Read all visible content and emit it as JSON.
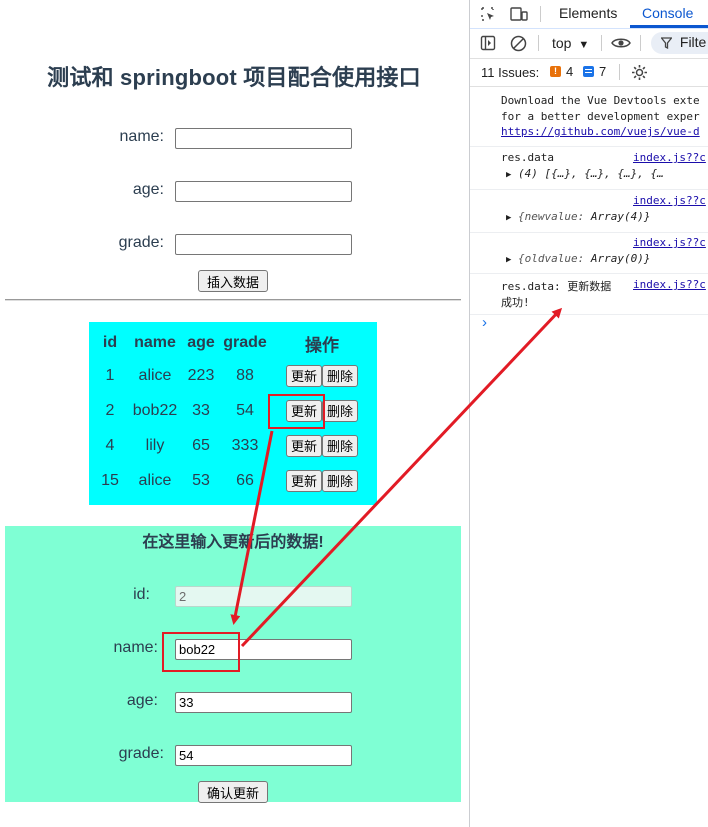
{
  "page": {
    "title": "测试和 springboot 项目配合使用接口"
  },
  "insert_form": {
    "name_label": "name:",
    "age_label": "age:",
    "grade_label": "grade:",
    "name_value": "",
    "age_value": "",
    "grade_value": "",
    "submit_label": "插入数据"
  },
  "table": {
    "headers": [
      "id",
      "name",
      "age",
      "grade",
      "操作"
    ],
    "rows": [
      {
        "id": "1",
        "name": "alice",
        "age": "223",
        "grade": "88"
      },
      {
        "id": "2",
        "name": "bob22",
        "age": "33",
        "grade": "54"
      },
      {
        "id": "4",
        "name": "lily",
        "age": "65",
        "grade": "333"
      },
      {
        "id": "15",
        "name": "alice",
        "age": "53",
        "grade": "66"
      }
    ],
    "update_label": "更新",
    "delete_label": "删除"
  },
  "update_form": {
    "title": "在这里输入更新后的数据!",
    "id_label": "id:",
    "name_label": "name:",
    "age_label": "age:",
    "grade_label": "grade:",
    "id_value": "2",
    "name_value": "bob22",
    "age_value": "33",
    "grade_value": "54",
    "submit_label": "确认更新"
  },
  "devtools": {
    "tabs": [
      "Elements",
      "Console"
    ],
    "active_tab": "Console",
    "context": "top",
    "filter_placeholder": "Filte",
    "issues_label": "11 Issues:",
    "issues_warn": "4",
    "issues_info": "7",
    "messages": {
      "m1_line1": "Download the Vue Devtools exte",
      "m1_line2": "for a better development exper",
      "m1_line3": "https://github.com/vuejs/vue-d",
      "m2_text": "res.data",
      "m2_src": "index.js??c",
      "m2_detail": "(4) [{…}, {…}, {…}, {…",
      "m3_src": "index.js??c",
      "m3_detail_key": "{newvalue:",
      "m3_detail_val": "Array(4)}",
      "m4_src": "index.js??c",
      "m4_detail_key": "{oldvalue:",
      "m4_detail_val": "Array(0)}",
      "m5_text": "res.data: 更新数据",
      "m5_src": "index.js??c",
      "m5_line2": "成功!"
    },
    "prompt": "›"
  },
  "colors": {
    "table_bg": "#00ffff",
    "update_bg": "#7fffd4",
    "annotation": "#e21b25"
  }
}
